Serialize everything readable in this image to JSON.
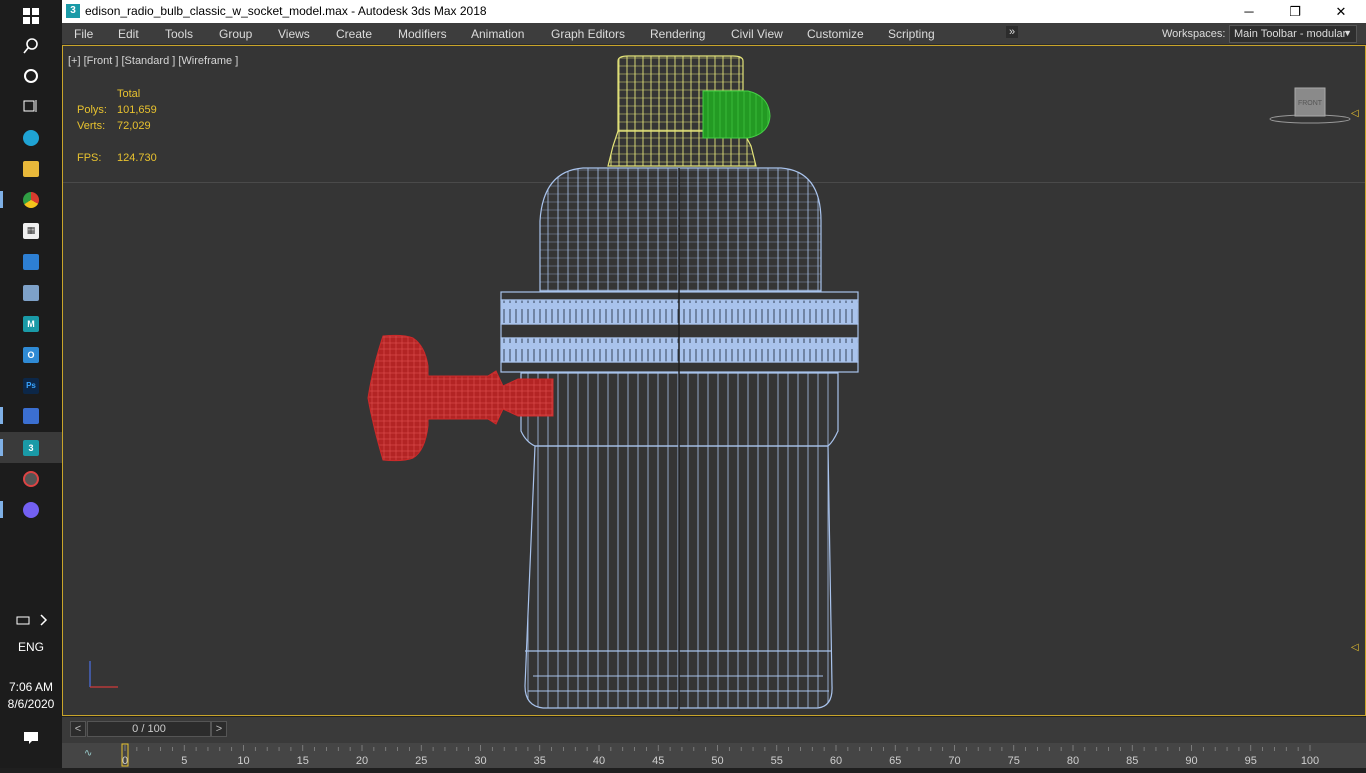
{
  "window": {
    "title": "edison_radio_bulb_classic_w_socket_model.max - Autodesk 3ds Max 2018",
    "app_icon": "3",
    "minimize": "─",
    "restore": "❐",
    "close": "✕"
  },
  "menu": [
    "File",
    "Edit",
    "Tools",
    "Group",
    "Views",
    "Create",
    "Modifiers",
    "Animation",
    "Graph Editors",
    "Rendering",
    "Civil View",
    "Customize",
    "Scripting"
  ],
  "menu_overflow": "»",
  "workspace": {
    "label": "Workspaces:",
    "value": "Main Toolbar - modular"
  },
  "viewport": {
    "label": "[+] [Front ] [Standard ] [Wireframe ]",
    "stats": {
      "header": "Total",
      "polys_label": "Polys:",
      "polys": "101,659",
      "verts_label": "Verts:",
      "verts": "72,029",
      "fps_label": "FPS:",
      "fps": "124.730"
    },
    "viewcube_label": "FRONT",
    "colors": {
      "socket": "#a9c3ec",
      "cap": "#e4e47a",
      "knob": "#cc2a2a",
      "small": "#2fb52f",
      "frame": "#c9a52a"
    }
  },
  "timeline": {
    "slider": "0 / 100",
    "prev": "<",
    "next": ">",
    "ticks": [
      "0",
      "5",
      "10",
      "15",
      "20",
      "25",
      "30",
      "35",
      "40",
      "45",
      "50",
      "55",
      "60",
      "65",
      "70",
      "75",
      "80",
      "85",
      "90",
      "95",
      "100"
    ]
  },
  "taskbar": {
    "icons": [
      "windows-start-icon",
      "search-icon",
      "cortana-icon",
      "task-view-icon",
      "edge-icon",
      "file-explorer-icon",
      "chrome-icon",
      "store-icon",
      "remote-desktop-icon",
      "photos-icon",
      "maya-icon",
      "outlook-icon",
      "photoshop-icon",
      "save-app-icon",
      "3dsmax-icon",
      "media-icon",
      "viber-icon"
    ],
    "lang": "ENG",
    "time": "7:06 AM",
    "date": "8/6/2020"
  }
}
